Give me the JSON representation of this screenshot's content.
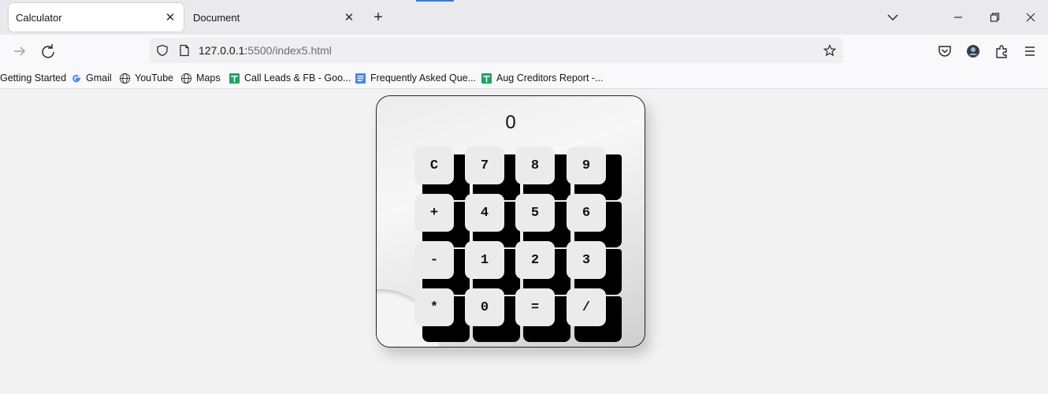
{
  "tabs": [
    {
      "title": "Calculator",
      "active": true
    },
    {
      "title": "Document",
      "active": false
    }
  ],
  "tab_close_glyph": "✕",
  "new_tab_glyph": "+",
  "url": {
    "host": "127.0.0.1:",
    "rest": "5500/index5.html"
  },
  "bookmarks": [
    {
      "label": "Getting Started",
      "icon": "firefox-icon"
    },
    {
      "label": "Gmail",
      "icon": "google-icon"
    },
    {
      "label": "YouTube",
      "icon": "globe-icon"
    },
    {
      "label": "Maps",
      "icon": "globe-icon"
    },
    {
      "label": "Call Leads & FB - Goo...",
      "icon": "sheets-icon"
    },
    {
      "label": "Frequently Asked Que...",
      "icon": "docs-icon"
    },
    {
      "label": "Aug Creditors Report -...",
      "icon": "sheets-icon"
    }
  ],
  "calculator": {
    "display": "0",
    "keys": [
      "C",
      "7",
      "8",
      "9",
      "+",
      "4",
      "5",
      "6",
      "-",
      "1",
      "2",
      "3",
      "*",
      "0",
      "=",
      "/"
    ]
  },
  "colors": {
    "accent": "#3d7bd6",
    "sheets": "#1fa463",
    "docs": "#4a86e8"
  }
}
